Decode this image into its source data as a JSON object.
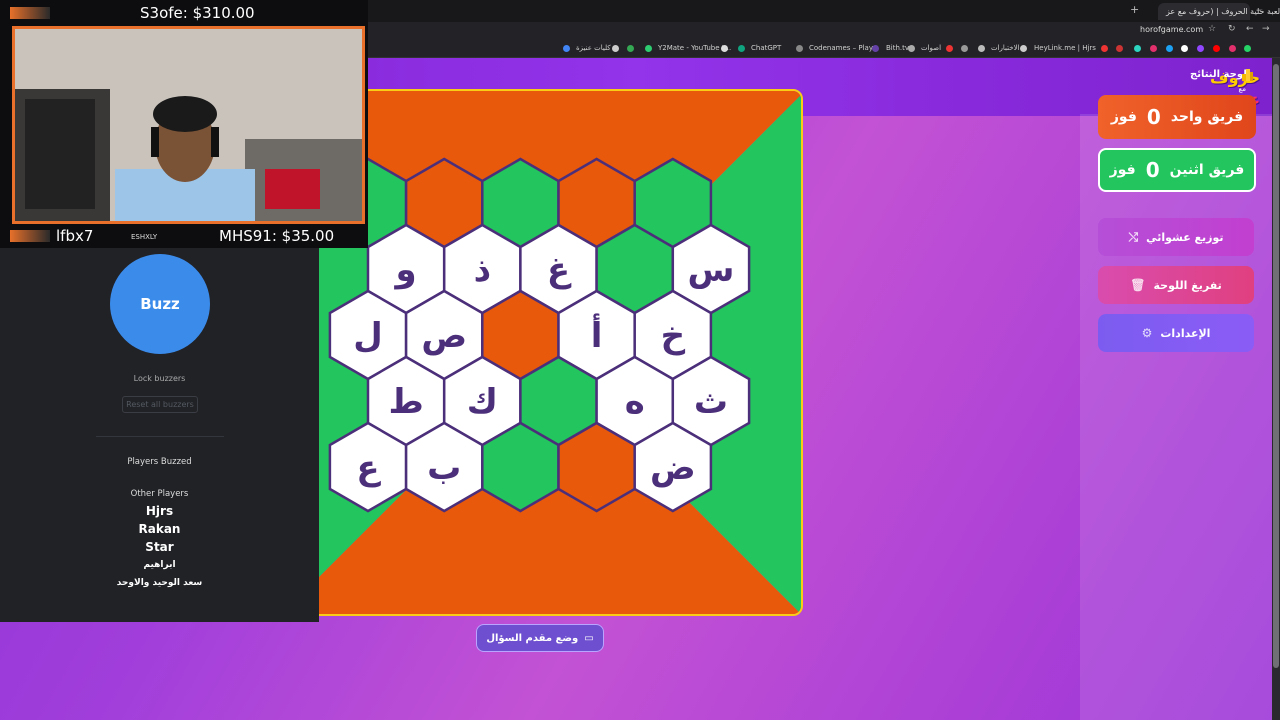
{
  "browser": {
    "tabs": [
      "لعبة خلية الحروف | (حروف مع عز..."
    ],
    "url": "horofgame.com",
    "bookmarks": [
      "كليات عنيزة",
      "Y2Mate - YouTube t...",
      "ChatGPT",
      "Codenames – Play...",
      "Bith.tv",
      "اصوات",
      "الاختبارات",
      "HeyLink.me | Hjrs"
    ]
  },
  "stream": {
    "donation_top": "S3ofe: $310.00",
    "donation_bottom": "MHS91: $35.00",
    "follower": "lfbx7",
    "cam_label": "ESHXLY"
  },
  "buzzer": {
    "buzz_label": "Buzz",
    "lock_label": "Lock buzzers",
    "reset_label": "Reset all buzzers",
    "players_buzzed_title": "Players Buzzed",
    "other_players_title": "Other Players",
    "other_players": [
      "Hjrs",
      "Rakan",
      "Star",
      "ابراهيم",
      "سعد الوحيد والاوحد"
    ]
  },
  "game": {
    "logo_top": "حروف",
    "logo_mid": "مع",
    "logo_bottom": "عجيزي",
    "scoreboard_title": "لوحة النتائج",
    "team1": {
      "name": "فريق واحد",
      "score": "0",
      "unit": "فوز",
      "color": "#e8501f"
    },
    "team2": {
      "name": "فريق اثنين",
      "score": "0",
      "unit": "فوز",
      "color": "#22c55e"
    },
    "random_button": "توزيع عشوائي",
    "clear_button": "تفريغ اللوحة",
    "settings_button": "الإعدادات",
    "presenter_button": "وضع مقدم السؤال",
    "board_colors": {
      "orange": "#e8590c",
      "green": "#22c55e",
      "white": "#ffffff",
      "letter": "#4c2f7a"
    },
    "hex_rows": [
      [
        {
          "c": "green",
          "l": ""
        },
        {
          "c": "orange",
          "l": ""
        },
        {
          "c": "green",
          "l": ""
        },
        {
          "c": "orange",
          "l": ""
        },
        {
          "c": "green",
          "l": ""
        }
      ],
      [
        {
          "c": "white",
          "l": "و"
        },
        {
          "c": "white",
          "l": "ذ"
        },
        {
          "c": "white",
          "l": "غ"
        },
        {
          "c": "green",
          "l": ""
        },
        {
          "c": "white",
          "l": "س"
        }
      ],
      [
        {
          "c": "white",
          "l": "ل"
        },
        {
          "c": "white",
          "l": "ص"
        },
        {
          "c": "orange",
          "l": ""
        },
        {
          "c": "white",
          "l": "أ"
        },
        {
          "c": "white",
          "l": "خ"
        }
      ],
      [
        {
          "c": "white",
          "l": "ط"
        },
        {
          "c": "white",
          "l": "ك"
        },
        {
          "c": "green",
          "l": ""
        },
        {
          "c": "white",
          "l": "ه"
        },
        {
          "c": "white",
          "l": "ث"
        }
      ],
      [
        {
          "c": "white",
          "l": "ع"
        },
        {
          "c": "white",
          "l": "ب"
        },
        {
          "c": "green",
          "l": ""
        },
        {
          "c": "orange",
          "l": ""
        },
        {
          "c": "white",
          "l": "ض"
        }
      ]
    ]
  }
}
